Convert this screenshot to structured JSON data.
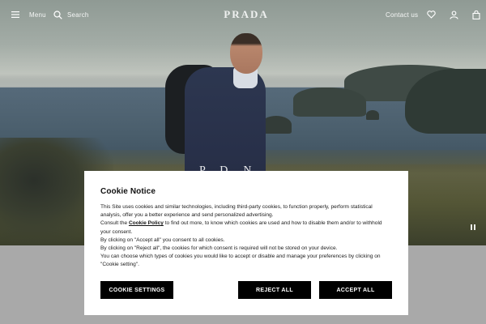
{
  "header": {
    "menu_label": "Menu",
    "search_label": "Search",
    "logo_text": "PRADA",
    "contact_label": "Contact us",
    "icons": [
      "menu-icon",
      "search-icon",
      "wishlist-heart-icon",
      "account-icon",
      "shopping-bag-icon"
    ]
  },
  "hero": {
    "title_text": "P... D... N...",
    "pause_icon": "pause-icon"
  },
  "cookie_notice": {
    "title": "Cookie Notice",
    "para1": "This Site uses cookies and similar technologies, including third-party cookies, to function properly, perform statistical analysis, offer you a better experience and send personalized advertising.",
    "para2_prefix": "Consult the ",
    "policy_link": "Cookie Policy",
    "para2_suffix": " to find out more, to know which cookies are used and how to disable them and/or to withhold your consent.",
    "para3": "By clicking on \"Accept all\" you consent to all cookies.",
    "para4": "By clicking on \"Reject all\", the cookies for which consent is required will not be stored on your device.",
    "para5": "You can choose which types of cookies you would like to accept or disable and manage your preferences by clicking on \"Cookie setting\".",
    "settings_button": "COOKIE SETTINGS",
    "reject_button": "REJECT ALL",
    "accept_button": "ACCEPT ALL"
  },
  "colors": {
    "button_bg": "#000000",
    "button_text": "#ffffff",
    "overlay": "#a9a9a9"
  }
}
